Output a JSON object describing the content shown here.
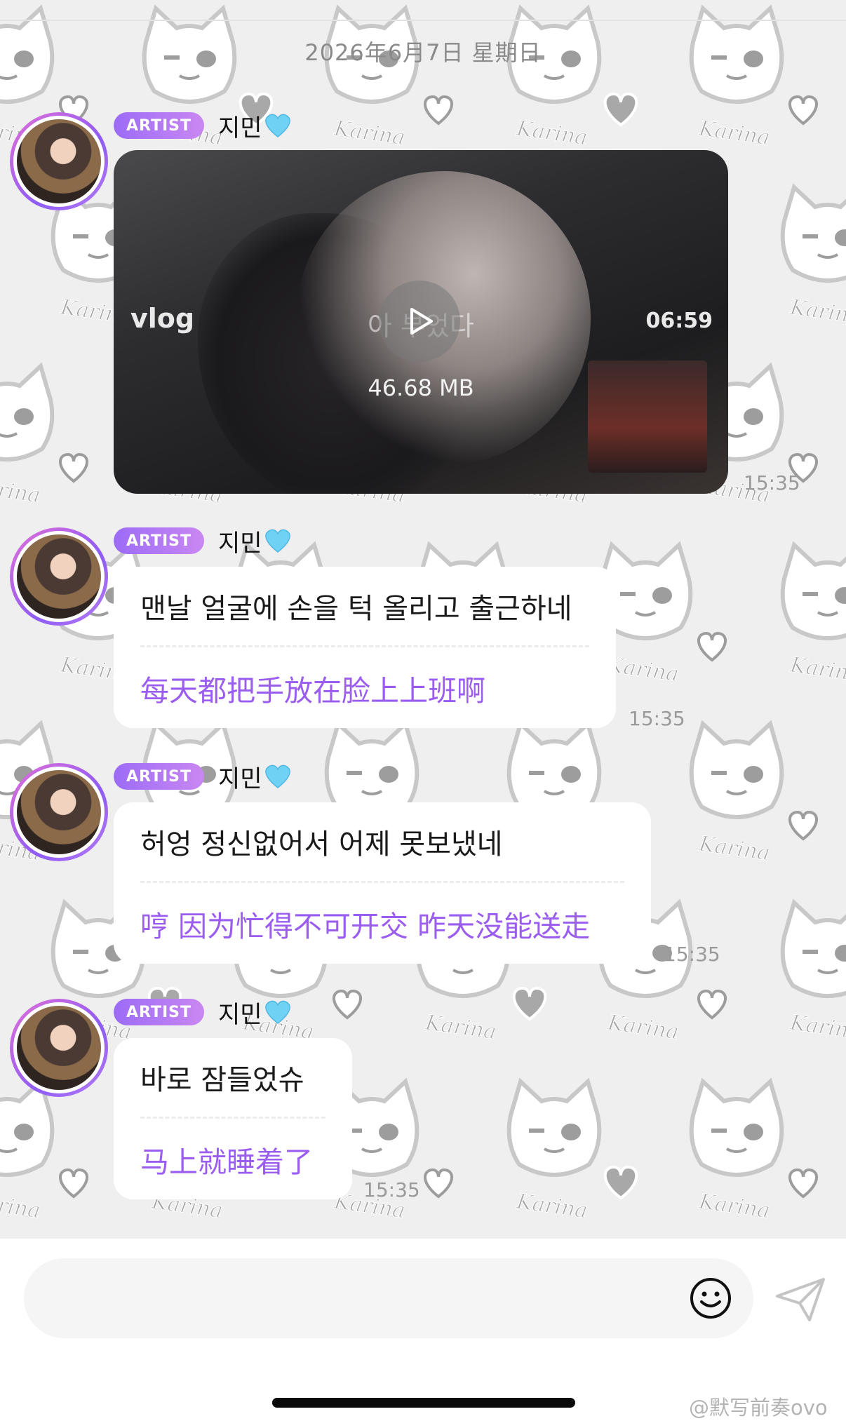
{
  "chat": {
    "date": "2026年6月7日 星期日",
    "pattern_word": "Karina",
    "messages": [
      {
        "badge": "ARTIST",
        "sender": "지민",
        "type": "video",
        "video_title": "vlog",
        "video_caption": "아 부었다",
        "duration": "06:59",
        "size": "46.68 MB",
        "time": "15:35"
      },
      {
        "badge": "ARTIST",
        "sender": "지민",
        "type": "text",
        "original": "맨날 얼굴에 손을 턱 올리고 출근하네",
        "translation": "每天都把手放在脸上上班啊",
        "time": "15:35"
      },
      {
        "badge": "ARTIST",
        "sender": "지민",
        "type": "text",
        "original": "허엉 정신없어서 어제 못보냈네",
        "translation": "哼 因为忙得不可开交 昨天没能送走",
        "time": "15:35"
      },
      {
        "badge": "ARTIST",
        "sender": "지민",
        "type": "text",
        "original": "바로 잠들었슈",
        "translation": "马上就睡着了",
        "time": "15:35"
      }
    ]
  },
  "input": {
    "emoji_icon": "smile-icon",
    "send_icon": "paper-plane-icon"
  },
  "watermark": "@默写前奏ovo",
  "colors": {
    "accent_purple": "#9b5cf0",
    "badge_gradient_start": "#9c6cf6",
    "heart_blue": "#6fd2f5"
  }
}
